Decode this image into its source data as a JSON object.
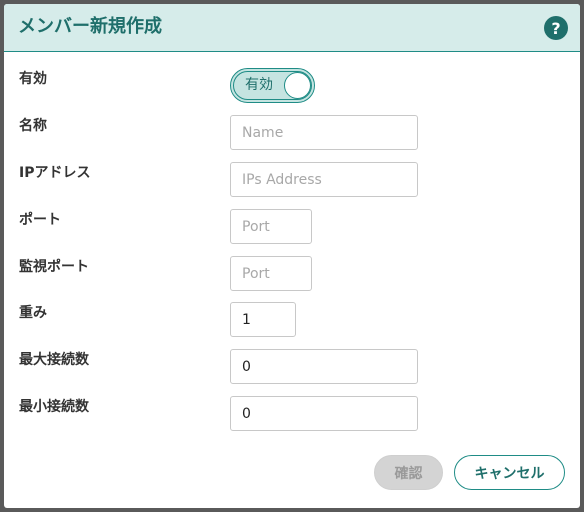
{
  "dialog": {
    "title": "メンバー新規作成",
    "help_icon": "?"
  },
  "form": {
    "enabled": {
      "label": "有効",
      "toggle_text": "有効",
      "state": "on"
    },
    "name": {
      "label": "名称",
      "placeholder": "Name",
      "value": ""
    },
    "ip_address": {
      "label": "IPアドレス",
      "placeholder": "IPs Address",
      "value": ""
    },
    "port": {
      "label": "ポート",
      "placeholder": "Port",
      "value": ""
    },
    "monitor_port": {
      "label": "監視ポート",
      "placeholder": "Port",
      "value": ""
    },
    "weight": {
      "label": "重み",
      "value": "1"
    },
    "max_connections": {
      "label": "最大接続数",
      "value": "0"
    },
    "min_connections": {
      "label": "最小接続数",
      "value": "0"
    }
  },
  "buttons": {
    "confirm": "確認",
    "cancel": "キャンセル"
  },
  "colors": {
    "accent": "#1f8c86",
    "header_bg": "#d6ecea",
    "toggle_bg": "#c5e4e1"
  }
}
